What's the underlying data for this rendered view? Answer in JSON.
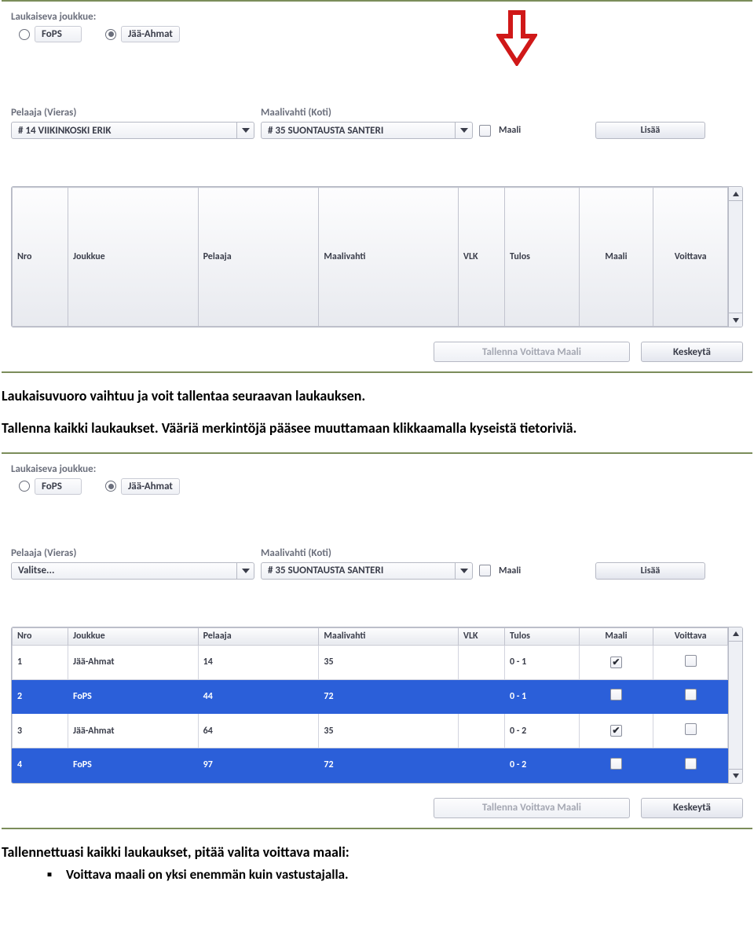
{
  "panel1": {
    "teams_label": "Laukaiseva joukkue:",
    "team1": "FoPS",
    "team2": "Jää-Ahmat",
    "player_label": "Pelaaja (Vieras)",
    "goalie_label": "Maalivahti (Koti)",
    "player_value": "# 14 VIIKINKOSKI ERIK",
    "goalie_value": "# 35 SUONTAUSTA SANTERI",
    "goal_check_label": "Maali",
    "add_btn": "Lisää",
    "columns": {
      "nro": "Nro",
      "joukkue": "Joukkue",
      "pelaaja": "Pelaaja",
      "maalivahti": "Maalivahti",
      "vlk": "VLK",
      "tulos": "Tulos",
      "maali": "Maali",
      "voittava": "Voittava"
    },
    "save_btn": "Tallenna Voittava Maali",
    "cancel_btn": "Keskeytä"
  },
  "doc_para1": "Laukaisuvuoro vaihtuu ja voit tallentaa seuraavan laukauksen.",
  "doc_para2": "Tallenna kaikki laukaukset. Vääriä merkintöjä pääsee muuttamaan klikkaamalla kyseistä tietoriviä.",
  "panel2": {
    "teams_label": "Laukaiseva joukkue:",
    "team1": "FoPS",
    "team2": "Jää-Ahmat",
    "player_label": "Pelaaja (Vieras)",
    "goalie_label": "Maalivahti (Koti)",
    "player_value": "Valitse...",
    "goalie_value": "# 35 SUONTAUSTA SANTERI",
    "goal_check_label": "Maali",
    "add_btn": "Lisää",
    "columns": {
      "nro": "Nro",
      "joukkue": "Joukkue",
      "pelaaja": "Pelaaja",
      "maalivahti": "Maalivahti",
      "vlk": "VLK",
      "tulos": "Tulos",
      "maali": "Maali",
      "voittava": "Voittava"
    },
    "rows": [
      {
        "nro": "1",
        "joukkue": "Jää-Ahmat",
        "pelaaja": "14",
        "maalivahti": "35",
        "vlk": "",
        "tulos": "0 - 1",
        "maali": true,
        "voittava": false,
        "sel": false
      },
      {
        "nro": "2",
        "joukkue": "FoPS",
        "pelaaja": "44",
        "maalivahti": "72",
        "vlk": "",
        "tulos": "0 - 1",
        "maali": false,
        "voittava": false,
        "sel": true
      },
      {
        "nro": "3",
        "joukkue": "Jää-Ahmat",
        "pelaaja": "64",
        "maalivahti": "35",
        "vlk": "",
        "tulos": "0 - 2",
        "maali": true,
        "voittava": false,
        "sel": false
      },
      {
        "nro": "4",
        "joukkue": "FoPS",
        "pelaaja": "97",
        "maalivahti": "72",
        "vlk": "",
        "tulos": "0 - 2",
        "maali": false,
        "voittava": false,
        "sel": true
      }
    ],
    "save_btn": "Tallenna Voittava Maali",
    "cancel_btn": "Keskeytä"
  },
  "doc_para3": "Tallennettuasi kaikki laukaukset, pitää valita voittava maali:",
  "doc_bullet1": "Voittava maali on yksi enemmän kuin vastustajalla."
}
